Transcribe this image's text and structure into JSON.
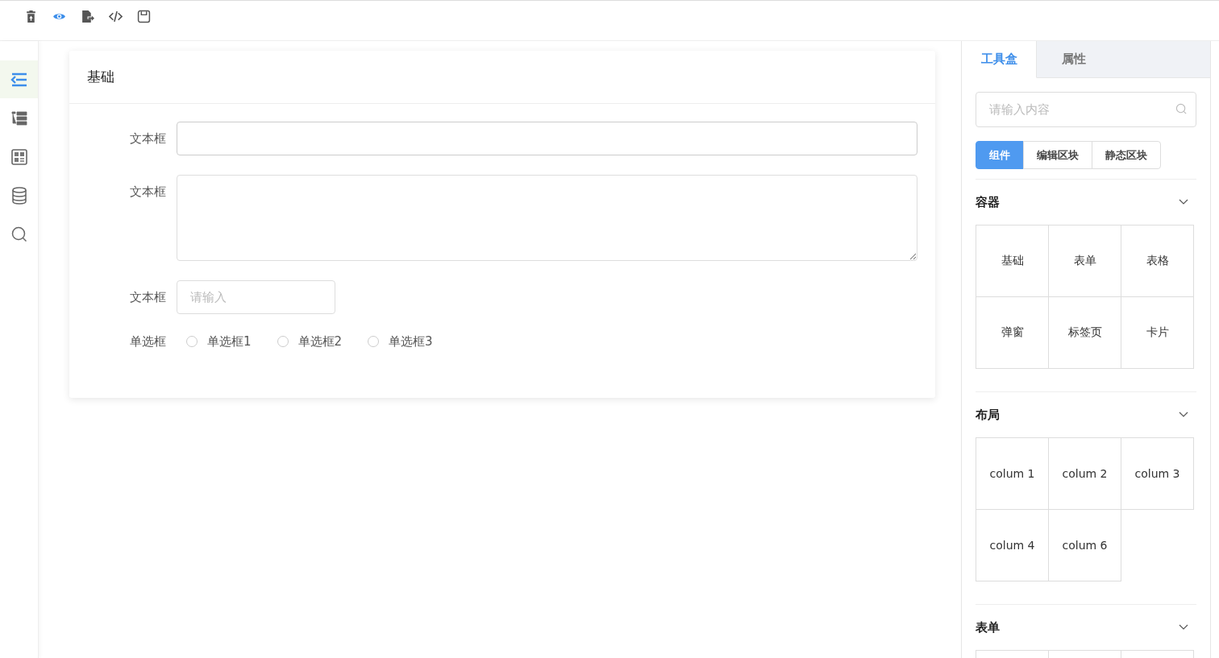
{
  "sidebar": {
    "items": [
      {
        "selected": true
      },
      {
        "selected": false
      },
      {
        "selected": false
      },
      {
        "selected": false
      },
      {
        "selected": false
      }
    ]
  },
  "card": {
    "title": "基础",
    "fields": [
      {
        "kind": "input",
        "label": "文本框"
      },
      {
        "kind": "textarea",
        "label": "文本框"
      },
      {
        "kind": "short-input",
        "label": "文本框",
        "placeholder": "请输入"
      },
      {
        "kind": "radio",
        "label": "单选框",
        "options": [
          {
            "label": "单选框1",
            "selected": false
          },
          {
            "label": "单选框2",
            "selected": false
          },
          {
            "label": "单选框3",
            "selected": false
          }
        ]
      }
    ]
  },
  "panel": {
    "tabs": [
      {
        "label": "工具盒",
        "selected": true
      },
      {
        "label": "属性",
        "selected": false
      }
    ],
    "search": {
      "placeholder": "请输入内容"
    },
    "segments": [
      {
        "label": "组件",
        "selected": true
      },
      {
        "label": "编辑区块",
        "selected": false
      },
      {
        "label": "静态区块",
        "selected": false
      }
    ],
    "sections": [
      {
        "title": "容器",
        "expanded": true,
        "items": [
          "基础",
          "表单",
          "表格",
          "弹窗",
          "标签页",
          "卡片"
        ]
      },
      {
        "title": "布局",
        "expanded": true,
        "items": [
          "colum 1",
          "colum 2",
          "colum 3",
          "colum 4",
          "colum 6"
        ]
      },
      {
        "title": "表单",
        "expanded": true
      }
    ]
  }
}
